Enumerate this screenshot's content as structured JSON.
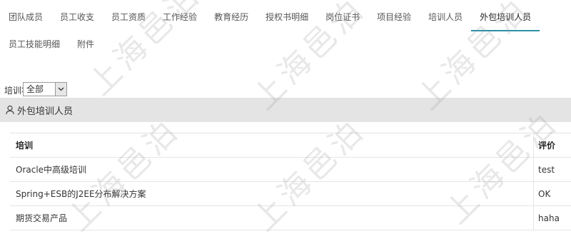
{
  "tabs": {
    "row1": [
      {
        "label": "团队成员"
      },
      {
        "label": "员工收支"
      },
      {
        "label": "员工资质"
      },
      {
        "label": "工作经验"
      },
      {
        "label": "教育经历"
      },
      {
        "label": "授权书明细"
      },
      {
        "label": "岗位证书"
      },
      {
        "label": "项目经验"
      },
      {
        "label": "培训人员"
      },
      {
        "label": "外包培训人员",
        "active": true
      }
    ],
    "row2": [
      {
        "label": "员工技能明细"
      },
      {
        "label": "附件"
      }
    ]
  },
  "filter": {
    "label": "培训状态",
    "selected": "全部"
  },
  "section": {
    "title": "外包培训人员",
    "icon": "user-icon"
  },
  "table": {
    "columns": [
      "培训",
      "评价"
    ],
    "rows": [
      [
        "Oracle中高级培训",
        "test"
      ],
      [
        "Spring+ESB的J2EE分布解决方案",
        "OK"
      ],
      [
        "期货交易产品",
        "haha"
      ]
    ]
  },
  "watermark": {
    "text": "上海邑泊"
  },
  "colors": {
    "active_tab_underline": "#2d8fa6",
    "section_bar": "#e4e4e4"
  }
}
